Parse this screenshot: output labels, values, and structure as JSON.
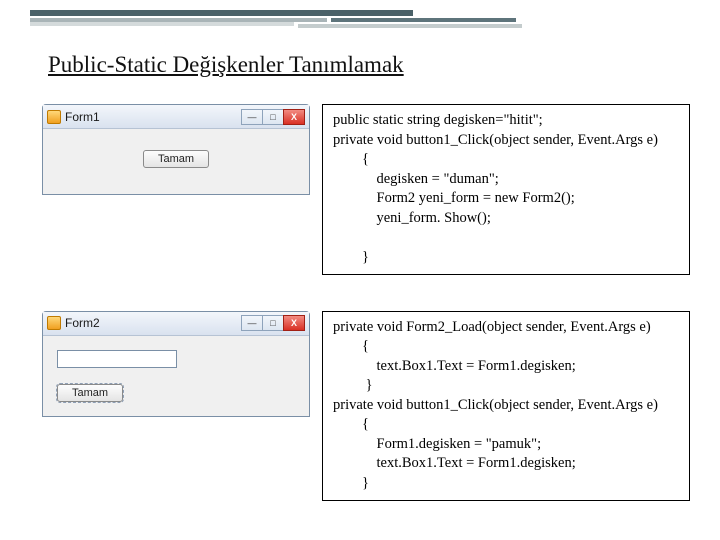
{
  "title": "Public-Static Değişkenler Tanımlamak",
  "form1": {
    "caption": "Form1",
    "button_label": "Tamam",
    "min_glyph": "—",
    "max_glyph": "□",
    "close_glyph": "X"
  },
  "form2": {
    "caption": "Form2",
    "button_label": "Tamam",
    "textbox_value": "",
    "min_glyph": "—",
    "max_glyph": "□",
    "close_glyph": "X"
  },
  "code1": "public static string degisken=\"hitit\";\nprivate void button1_Click(object sender, Event.Args e)\n        {\n            degisken = \"duman\";\n            Form2 yeni_form = new Form2();\n            yeni_form. Show();\n\n        }",
  "code2": "private void Form2_Load(object sender, Event.Args e)\n        {\n            text.Box1.Text = Form1.degisken;\n         }\nprivate void button1_Click(object sender, Event.Args e)\n        {\n            Form1.degisken = \"pamuk\";\n            text.Box1.Text = Form1.degisken;\n        }"
}
